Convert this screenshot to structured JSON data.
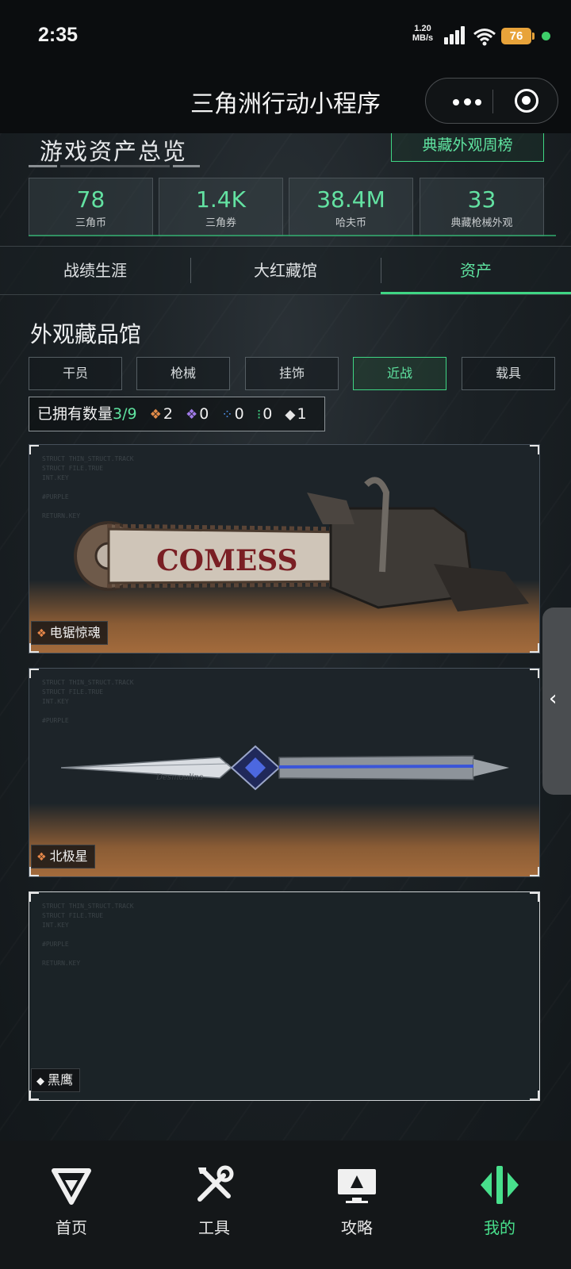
{
  "status_bar": {
    "time": "2:35",
    "net_speed": "1.20 MB/s",
    "net_type": "4G",
    "battery": "76"
  },
  "header": {
    "title": "三角洲行动小程序"
  },
  "assets": {
    "title": "游戏资产总览",
    "weekly_button": "典藏外观周榜",
    "stats": [
      {
        "value": "78",
        "label": "三角币"
      },
      {
        "value": "1.4K",
        "label": "三角券"
      },
      {
        "value": "38.4M",
        "label": "哈夫币"
      },
      {
        "value": "33",
        "label": "典藏枪械外观"
      }
    ]
  },
  "tabs": [
    {
      "label": "战绩生涯",
      "active": false
    },
    {
      "label": "大红藏馆",
      "active": false
    },
    {
      "label": "资产",
      "active": true
    }
  ],
  "gallery": {
    "title": "外观藏品馆",
    "filters": [
      {
        "label": "干员",
        "active": false
      },
      {
        "label": "枪械",
        "active": false
      },
      {
        "label": "挂饰",
        "active": false
      },
      {
        "label": "近战",
        "active": true
      },
      {
        "label": "载具",
        "active": false
      }
    ],
    "owned": {
      "label": "已拥有数量",
      "fraction": "3/9",
      "counts": [
        {
          "icon": "orange-diamond-icon",
          "color": "#e08a48",
          "value": "2"
        },
        {
          "icon": "purple-diamond-icon",
          "color": "#a07ae8",
          "value": "0"
        },
        {
          "icon": "blue-diamond-icon",
          "color": "#4d8fe6",
          "value": "0"
        },
        {
          "icon": "green-diamond-icon",
          "color": "#3fd684",
          "value": "0"
        },
        {
          "icon": "white-diamond-icon",
          "color": "#e6e6e6",
          "value": "1"
        }
      ]
    },
    "items": [
      {
        "name": "电锯惊魂",
        "rarity_color": "#e08a48",
        "image_text": "COMESS"
      },
      {
        "name": "北极星",
        "rarity_color": "#e08a48",
        "image_text": "Desmoulins"
      },
      {
        "name": "黑鹰",
        "rarity_color": "#e6e6e6"
      }
    ]
  },
  "bottom_nav": [
    {
      "label": "首页",
      "icon": "delta-logo-icon",
      "active": false
    },
    {
      "label": "工具",
      "icon": "tools-icon",
      "active": false
    },
    {
      "label": "攻略",
      "icon": "guide-monitor-icon",
      "active": false
    },
    {
      "label": "我的",
      "icon": "profile-emblem-icon",
      "active": true
    }
  ]
}
